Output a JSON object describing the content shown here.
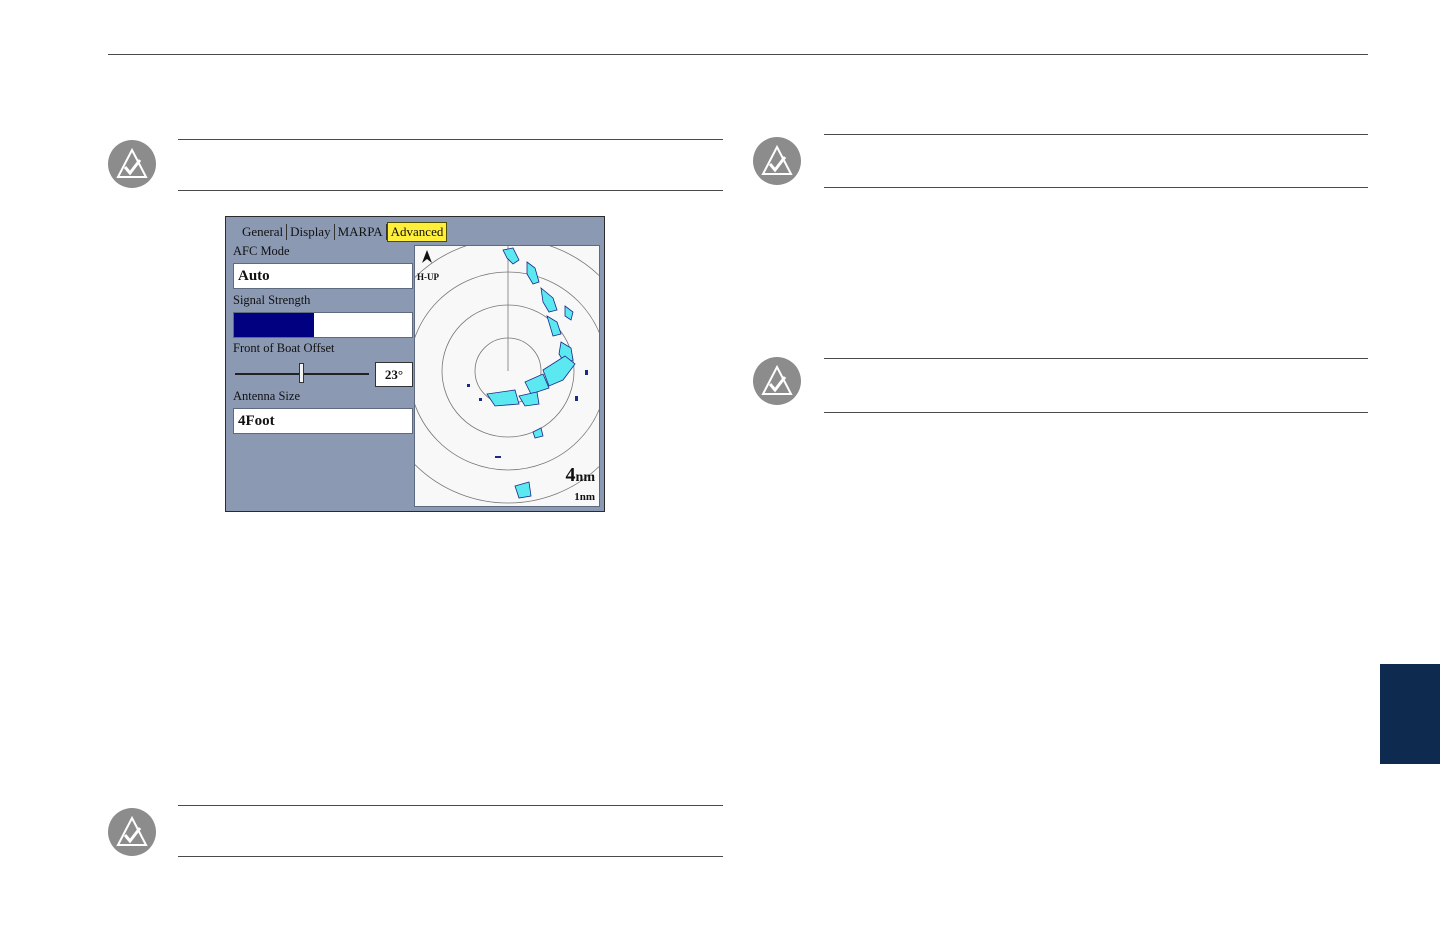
{
  "screen": {
    "tabs": [
      {
        "label": "General",
        "active": false
      },
      {
        "label": "Display",
        "active": false
      },
      {
        "label": "MARPA",
        "active": false
      },
      {
        "label": "Advanced",
        "active": true
      }
    ],
    "afc_mode": {
      "label": "AFC Mode",
      "value": "Auto"
    },
    "signal_strength": {
      "label": "Signal Strength",
      "level": 0.45
    },
    "front_of_boat_offset": {
      "label": "Front of Boat Offset",
      "value": "23°"
    },
    "antenna_size": {
      "label": "Antenna Size",
      "value": "4Foot"
    },
    "radar": {
      "orientation": "H-UP",
      "range_value": "4",
      "range_unit": "nm",
      "ring_spacing": "1nm"
    }
  },
  "icons": {
    "note": "note-checkmark-icon",
    "heading": "heading-arrow-icon"
  },
  "colors": {
    "screen_bg": "#8b99b3",
    "active_tab": "#ffef3a",
    "signal_bar": "#000080",
    "radar_echo": "#5ce8f0",
    "side_tab": "#0f2a4f"
  }
}
